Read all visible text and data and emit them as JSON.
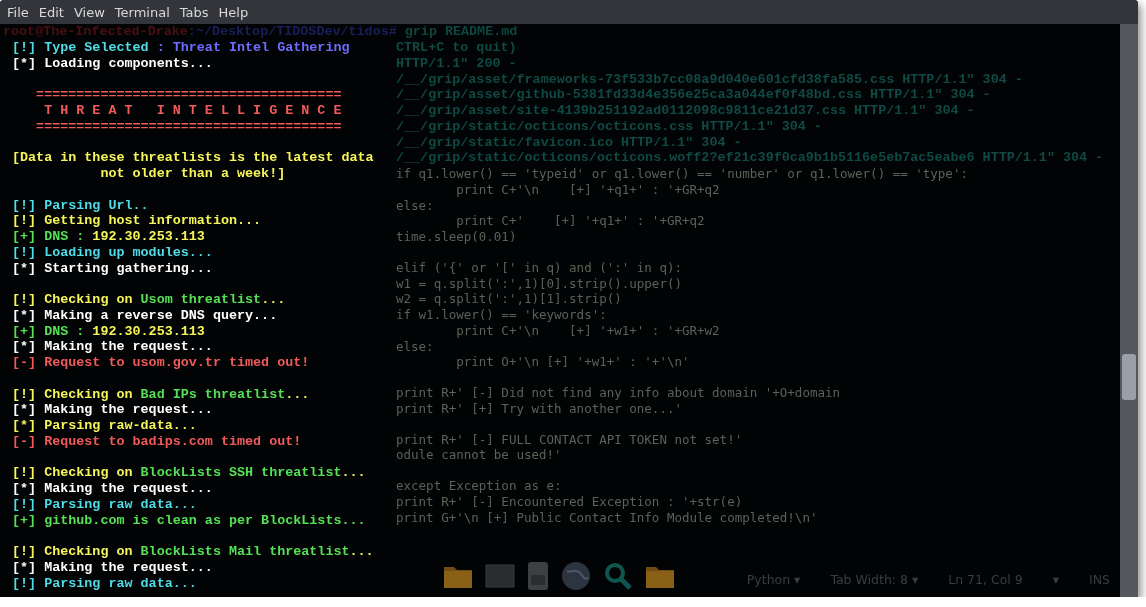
{
  "menu": [
    "File",
    "Edit",
    "View",
    "Terminal",
    "Tabs",
    "Help"
  ],
  "prompt": {
    "user": "root@The-Infected-Drake",
    "path": ":~/Desktop/TIDOSDev/tidos#",
    "command": " grip README.md"
  },
  "lines": [
    {
      "segments": [
        {
          "text": "[!] Type Selected ",
          "color": "#4fdce6"
        },
        {
          "text": ": Threat Intel Gathering",
          "color": "#6e6cff"
        }
      ]
    },
    {
      "segments": [
        {
          "text": "[*] Loading components...",
          "color": "#ffffff"
        }
      ]
    },
    {
      "kind": "blank"
    },
    {
      "segments": [
        {
          "text": "   ======================================",
          "color": "#f05a5a"
        }
      ]
    },
    {
      "segments": [
        {
          "text": "    T H R E A T   I N T E L L I G E N C E",
          "color": "#f05a5a"
        }
      ]
    },
    {
      "segments": [
        {
          "text": "   ======================================",
          "color": "#f05a5a"
        }
      ]
    },
    {
      "kind": "blank"
    },
    {
      "segments": [
        {
          "text": "[Data in these threatlists is the latest data",
          "color": "#f6f65a"
        }
      ]
    },
    {
      "segments": [
        {
          "text": "           not older than a week!]",
          "color": "#f6f65a"
        }
      ]
    },
    {
      "kind": "blank"
    },
    {
      "segments": [
        {
          "text": "[!] Parsing Url..",
          "color": "#4fdce6"
        }
      ]
    },
    {
      "segments": [
        {
          "text": "[!] Getting host information...",
          "color": "#f6f65a"
        }
      ]
    },
    {
      "segments": [
        {
          "text": "[+] DNS : ",
          "color": "#55e055"
        },
        {
          "text": "192.30.253.113",
          "color": "#f6f65a"
        }
      ]
    },
    {
      "segments": [
        {
          "text": "[!] Loading up modules...",
          "color": "#4fdce6"
        }
      ]
    },
    {
      "segments": [
        {
          "text": "[*] Starting gathering...",
          "color": "#ffffff"
        }
      ]
    },
    {
      "kind": "blank"
    },
    {
      "segments": [
        {
          "text": "[!] Checking on ",
          "color": "#f6f65a"
        },
        {
          "text": "Usom threatlist",
          "color": "#55e055"
        },
        {
          "text": "...",
          "color": "#f6f65a"
        }
      ]
    },
    {
      "segments": [
        {
          "text": "[*] Making a reverse DNS query...",
          "color": "#ffffff"
        }
      ]
    },
    {
      "segments": [
        {
          "text": "[+] DNS : ",
          "color": "#55e055"
        },
        {
          "text": "192.30.253.113",
          "color": "#f6f65a"
        }
      ]
    },
    {
      "segments": [
        {
          "text": "[*] Making the request...",
          "color": "#ffffff"
        }
      ]
    },
    {
      "segments": [
        {
          "text": "[-] Request to usom.gov.tr timed out!",
          "color": "#f05a5a"
        }
      ]
    },
    {
      "kind": "blank"
    },
    {
      "segments": [
        {
          "text": "[!] Checking on ",
          "color": "#f6f65a"
        },
        {
          "text": "Bad IPs threatlist",
          "color": "#55e055"
        },
        {
          "text": "...",
          "color": "#f6f65a"
        }
      ]
    },
    {
      "segments": [
        {
          "text": "[*] Making the request...",
          "color": "#ffffff"
        }
      ]
    },
    {
      "segments": [
        {
          "text": "[*] Parsing raw-data...",
          "color": "#f6f65a"
        }
      ]
    },
    {
      "segments": [
        {
          "text": "[-] Request to badips.com timed out!",
          "color": "#f05a5a"
        }
      ]
    },
    {
      "kind": "blank"
    },
    {
      "segments": [
        {
          "text": "[!] Checking on ",
          "color": "#f6f65a"
        },
        {
          "text": "BlockLists SSH threatlist",
          "color": "#55e055"
        },
        {
          "text": "...",
          "color": "#f6f65a"
        }
      ]
    },
    {
      "segments": [
        {
          "text": "[*] Making the request...",
          "color": "#ffffff"
        }
      ]
    },
    {
      "segments": [
        {
          "text": "[!] Parsing raw data...",
          "color": "#4fdce6"
        }
      ]
    },
    {
      "segments": [
        {
          "text": "[+] github.com is clean as per BlockLists...",
          "color": "#55e055"
        }
      ]
    },
    {
      "kind": "blank"
    },
    {
      "segments": [
        {
          "text": "[!] Checking on ",
          "color": "#f6f65a"
        },
        {
          "text": "BlockLists Mail threatlist",
          "color": "#55e055"
        },
        {
          "text": "...",
          "color": "#f6f65a"
        }
      ]
    },
    {
      "segments": [
        {
          "text": "[*] Making the request...",
          "color": "#ffffff"
        }
      ]
    },
    {
      "segments": [
        {
          "text": "[!] Parsing raw data...",
          "color": "#4fdce6"
        }
      ]
    }
  ],
  "server_log": [
    "CTRL+C to quit)",
    "HTTP/1.1\" 200 -",
    "/__/grip/asset/frameworks-73f533b7cc08a9d040e601cfd38fa585.css HTTP/1.1\" 304 -",
    "/__/grip/asset/github-5381fd33d4e356e25ca3a044ef0f48bd.css HTTP/1.1\" 304 -",
    "/__/grip/asset/site-4139b251192ad0112098c9811ce21d37.css HTTP/1.1\" 304 -",
    "/__/grip/static/octicons/octicons.css HTTP/1.1\" 304 -",
    "/__/grip/static/favicon.ico HTTP/1.1\" 304 -",
    "/__/grip/static/octicons/octicons.woff2?ef21c39f0ca9b1b5116e5eb7ac5eabe6 HTTP/1.1\" 304 -"
  ],
  "editor_code": [
    [
      "if q1.lower() == 'typeid' or q1.lower() == 'number' or q1.lower() == 'type':",
      "        print C+'\\n    [+] '+q1+' : '+GR+q2",
      "else:",
      "        print C+'    [+] '+q1+' : '+GR+q2",
      "time.sleep(0.01)"
    ],
    [
      "elif ('{' or '[' in q) and (':' in q):",
      "w1 = q.split(':',1)[0].strip().upper()",
      "w2 = q.split(':',1)[1].strip()",
      "if w1.lower() == 'keywords':",
      "        print C+'\\n    [+] '+w1+' : '+GR+w2",
      "else:",
      "        print O+'\\n [+] '+w1+' : '+'\\n'"
    ],
    [
      "print R+' [-] Did not find any info about domain '+O+domain",
      "print R+' [+] Try with another one...'"
    ],
    [
      "print R+' [-] FULL CONTACT API TOKEN not set!'",
      "odule cannot be used!'"
    ],
    [
      "except Exception as e:",
      "print R+' [-] Encountered Exception : '+str(e)",
      "print G+'\\n [+] Public Contact Info Module completed!\\n'"
    ]
  ],
  "status_bar": [
    {
      "text": "Python ▾"
    },
    {
      "text": "Tab Width: 8 ▾"
    },
    {
      "text": "Ln 71, Col 9"
    },
    {
      "text": "▾"
    },
    {
      "text": "INS"
    }
  ]
}
